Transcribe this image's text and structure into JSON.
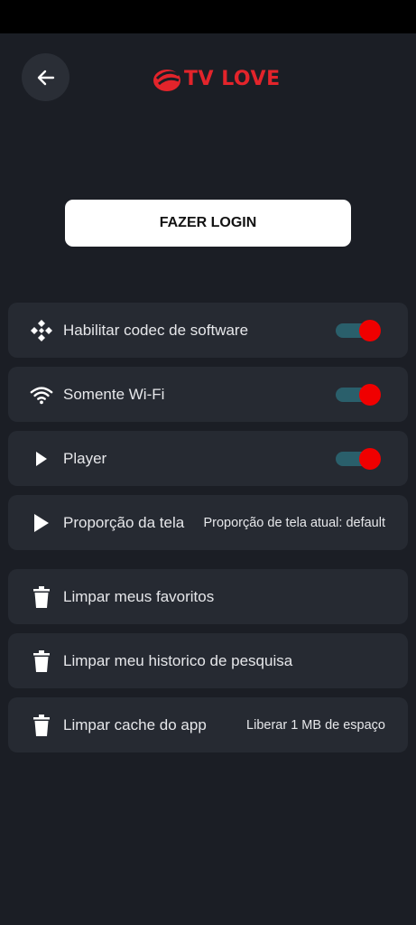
{
  "header": {
    "logo_text": "TV LOVE",
    "accent_color": "#e3242b",
    "back_icon": "arrow-left-icon"
  },
  "login_button": {
    "label": "FAZER LOGIN"
  },
  "settings": [
    {
      "label": "Habilitar codec de software",
      "icon": "codec-icon",
      "type": "toggle",
      "on": true
    },
    {
      "label": "Somente Wi-Fi",
      "icon": "wifi-icon",
      "type": "toggle",
      "on": true
    },
    {
      "label": "Player",
      "icon": "play-icon",
      "type": "toggle",
      "on": true
    },
    {
      "label": "Proporção da tela",
      "icon": "play-icon",
      "type": "value",
      "value": "Proporção de tela atual: default"
    },
    {
      "label": "Limpar meus favoritos",
      "icon": "trash-icon",
      "type": "action"
    },
    {
      "label": "Limpar meu historico de pesquisa",
      "icon": "trash-icon",
      "type": "action"
    },
    {
      "label": "Limpar cache do app",
      "icon": "trash-icon",
      "type": "value",
      "value": "Liberar 1 MB de espaço"
    }
  ],
  "colors": {
    "background": "#1b1e25",
    "row": "#262a32",
    "toggle_knob": "#f00000",
    "toggle_track": "#2a5f6b"
  }
}
